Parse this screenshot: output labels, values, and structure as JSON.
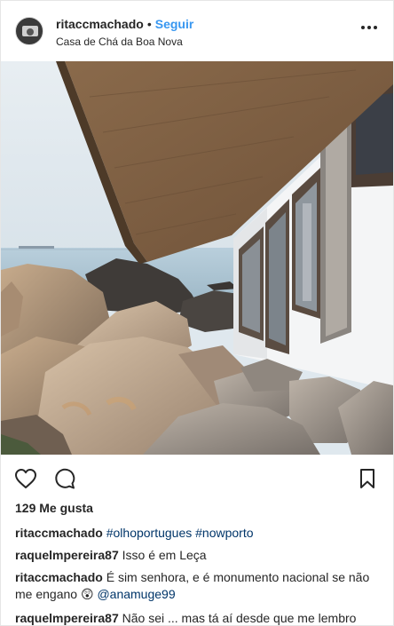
{
  "post": {
    "username": "ritaccmachado",
    "separator": "•",
    "follow_label": "Seguir",
    "location": "Casa de Chá da Boa Nova"
  },
  "icons": {
    "more": "more-options-icon",
    "like": "heart-icon",
    "comment": "comment-icon",
    "save": "bookmark-icon",
    "emoji": "astonished-face-emoji"
  },
  "likes": "129 Me gusta",
  "comments": [
    {
      "user": "ritaccmachado",
      "text": "",
      "tags": "#olhoportugues #nowporto"
    },
    {
      "user": "raquelmpereira87",
      "text": "Isso é em Leça",
      "tags": ""
    },
    {
      "user": "ritaccmachado",
      "text": "É sim senhora, e é monumento nacional se não me engano",
      "emoji": "😲",
      "tags": "@anamuge99"
    },
    {
      "user": "raquelmpereira87",
      "text": "Não sei ... mas tá aí desde que me lembro",
      "tags": ""
    }
  ],
  "colors": {
    "link": "#3897f0",
    "hashtag": "#003569",
    "text": "#262626"
  }
}
